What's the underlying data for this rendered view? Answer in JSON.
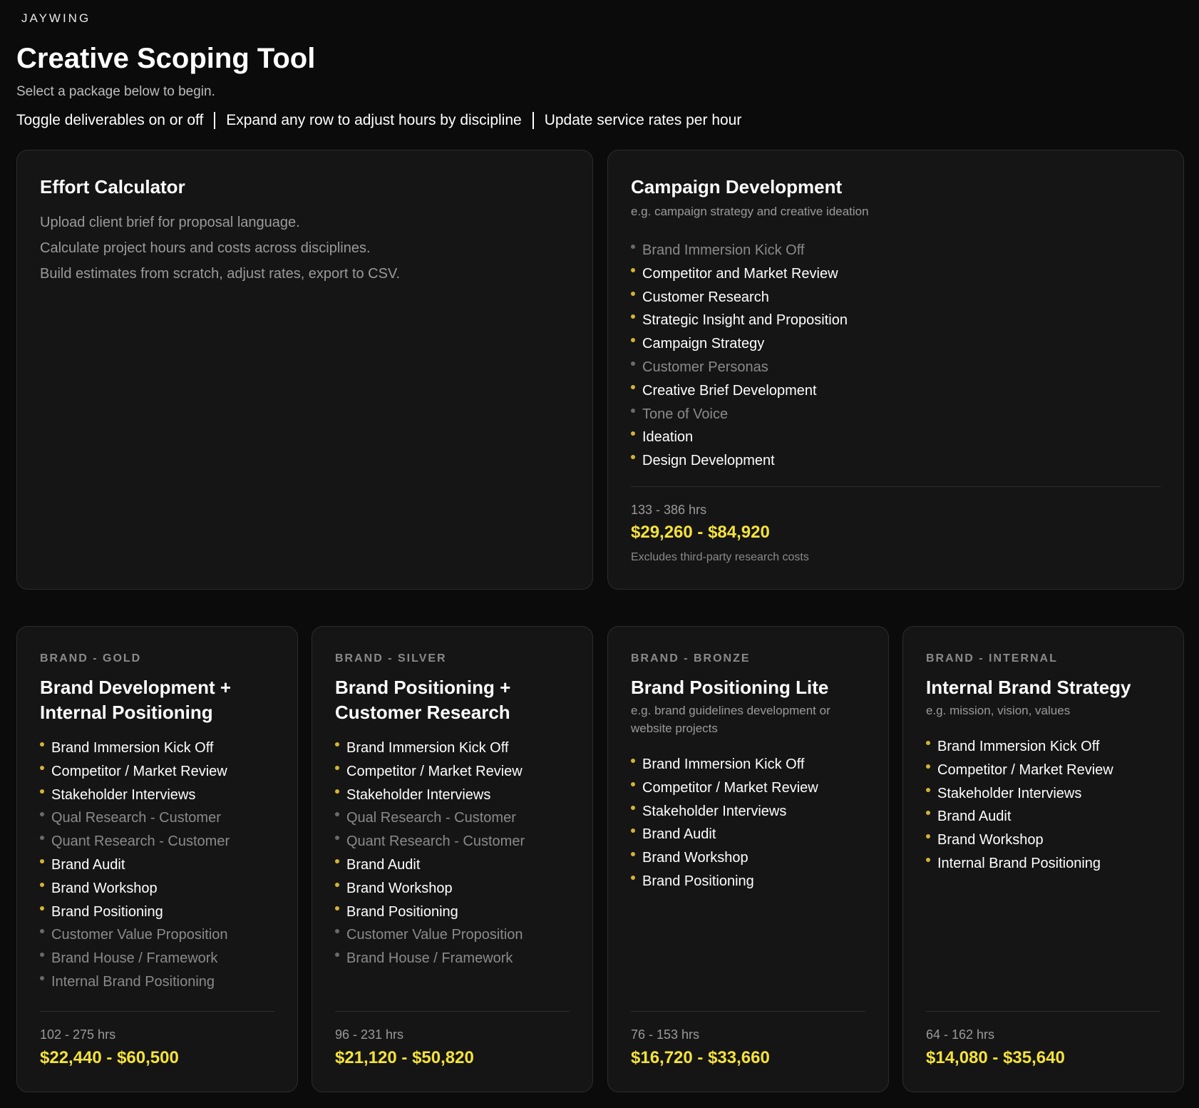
{
  "header": {
    "logo": "JAYWING",
    "title": "Creative Scoping Tool",
    "subtitle": "Select a package below to begin.",
    "instructions": [
      "Toggle deliverables on or off",
      "Expand any row to adjust hours by discipline",
      "Update service rates per hour"
    ]
  },
  "effort": {
    "title": "Effort Calculator",
    "lines": [
      "Upload client brief for proposal language.",
      "Calculate project hours and costs across disciplines.",
      "Build estimates from scratch, adjust rates, export to CSV."
    ]
  },
  "campaign": {
    "title": "Campaign Development",
    "desc": "e.g. campaign strategy and creative ideation",
    "items": [
      {
        "label": "Brand Immersion Kick Off",
        "on": false
      },
      {
        "label": "Competitor and Market Review",
        "on": true
      },
      {
        "label": "Customer Research",
        "on": true
      },
      {
        "label": "Strategic Insight and Proposition",
        "on": true
      },
      {
        "label": "Campaign Strategy",
        "on": true
      },
      {
        "label": "Customer Personas",
        "on": false
      },
      {
        "label": "Creative Brief Development",
        "on": true
      },
      {
        "label": "Tone of Voice",
        "on": false
      },
      {
        "label": "Ideation",
        "on": true
      },
      {
        "label": "Design Development",
        "on": true
      }
    ],
    "hours": "133 - 386 hrs",
    "price": "$29,260 - $84,920",
    "note": "Excludes third-party research costs"
  },
  "packages": [
    {
      "eyebrow": "BRAND - GOLD",
      "title_lines": [
        "Brand Development +",
        "Internal Positioning"
      ],
      "desc": "",
      "items": [
        {
          "label": "Brand Immersion Kick Off",
          "on": true
        },
        {
          "label": "Competitor / Market Review",
          "on": true
        },
        {
          "label": "Stakeholder Interviews",
          "on": true
        },
        {
          "label": "Qual Research - Customer",
          "on": false
        },
        {
          "label": "Quant Research - Customer",
          "on": false
        },
        {
          "label": "Brand Audit",
          "on": true
        },
        {
          "label": "Brand Workshop",
          "on": true
        },
        {
          "label": "Brand Positioning",
          "on": true
        },
        {
          "label": "Customer Value Proposition",
          "on": false
        },
        {
          "label": "Brand House / Framework",
          "on": false
        },
        {
          "label": "Internal Brand Positioning",
          "on": false
        }
      ],
      "hours": "102 - 275 hrs",
      "price": "$22,440 - $60,500"
    },
    {
      "eyebrow": "BRAND - SILVER",
      "title_lines": [
        "Brand Positioning +",
        "Customer Research"
      ],
      "desc": "",
      "items": [
        {
          "label": "Brand Immersion Kick Off",
          "on": true
        },
        {
          "label": "Competitor / Market Review",
          "on": true
        },
        {
          "label": "Stakeholder Interviews",
          "on": true
        },
        {
          "label": "Qual Research - Customer",
          "on": false
        },
        {
          "label": "Quant Research - Customer",
          "on": false
        },
        {
          "label": "Brand Audit",
          "on": true
        },
        {
          "label": "Brand Workshop",
          "on": true
        },
        {
          "label": "Brand Positioning",
          "on": true
        },
        {
          "label": "Customer Value Proposition",
          "on": false
        },
        {
          "label": "Brand House / Framework",
          "on": false
        }
      ],
      "hours": "96 - 231 hrs",
      "price": "$21,120 - $50,820"
    },
    {
      "eyebrow": "BRAND - BRONZE",
      "title_lines": [
        "Brand Positioning Lite"
      ],
      "desc": "e.g. brand guidelines development or website projects",
      "items": [
        {
          "label": "Brand Immersion Kick Off",
          "on": true
        },
        {
          "label": "Competitor / Market Review",
          "on": true
        },
        {
          "label": "Stakeholder Interviews",
          "on": true
        },
        {
          "label": "Brand Audit",
          "on": true
        },
        {
          "label": "Brand Workshop",
          "on": true
        },
        {
          "label": "Brand Positioning",
          "on": true
        }
      ],
      "hours": "76 - 153 hrs",
      "price": "$16,720 - $33,660"
    },
    {
      "eyebrow": "BRAND - INTERNAL",
      "title_lines": [
        "Internal Brand Strategy"
      ],
      "desc": "e.g. mission, vision, values",
      "items": [
        {
          "label": "Brand Immersion Kick Off",
          "on": true
        },
        {
          "label": "Competitor / Market Review",
          "on": true
        },
        {
          "label": "Stakeholder Interviews",
          "on": true
        },
        {
          "label": "Brand Audit",
          "on": true
        },
        {
          "label": "Brand Workshop",
          "on": true
        },
        {
          "label": "Internal Brand Positioning",
          "on": true
        }
      ],
      "hours": "64 - 162 hrs",
      "price": "$14,080 - $35,640"
    }
  ]
}
